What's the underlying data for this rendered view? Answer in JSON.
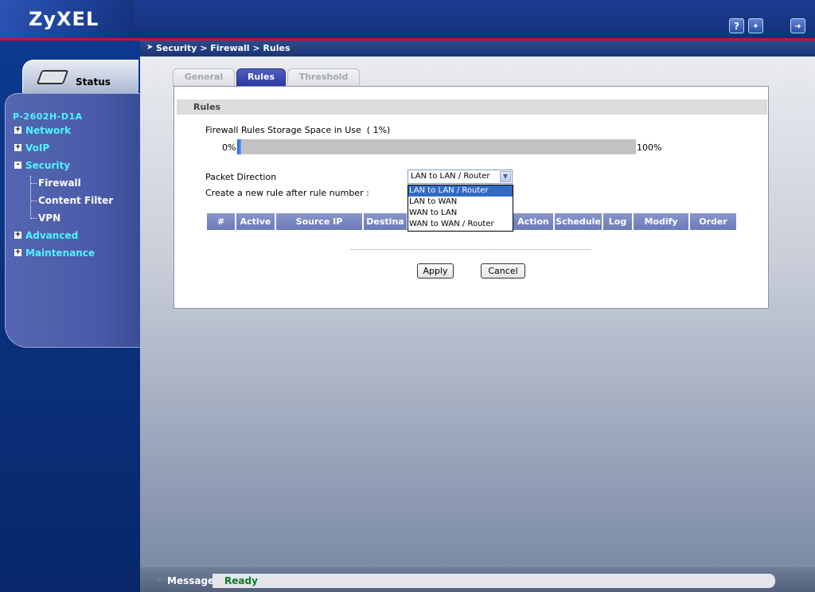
{
  "header": {
    "logo": "ZyXEL",
    "help_icon": "?",
    "wizard_icon": "wand-icon",
    "logout_icon": "logout-icon"
  },
  "sidebar": {
    "status_label": "Status",
    "model": "P-2602H-D1A",
    "items": [
      {
        "label": "Network",
        "toggle": "+"
      },
      {
        "label": "VoIP",
        "toggle": "+"
      },
      {
        "label": "Security",
        "toggle": "-"
      },
      {
        "label": "Advanced",
        "toggle": "+"
      },
      {
        "label": "Maintenance",
        "toggle": "+"
      }
    ],
    "security_sub": [
      "Firewall",
      "Content Filter",
      "VPN"
    ]
  },
  "breadcrumb": "Security > Firewall > Rules",
  "tabs": [
    {
      "label": "General",
      "active": false
    },
    {
      "label": "Rules",
      "active": true
    },
    {
      "label": "Threshold",
      "active": false
    }
  ],
  "section": {
    "title": "Rules",
    "storage_label": "Firewall Rules Storage Space in Use",
    "storage_pct_text": "( 1%)",
    "storage_fraction": 0.01,
    "min_label": "0%",
    "max_label": "100%",
    "packet_direction_label": "Packet Direction",
    "packet_direction_value": "LAN to LAN / Router",
    "packet_direction_options": [
      "LAN to LAN / Router",
      "LAN to WAN",
      "WAN to LAN",
      "WAN to WAN / Router"
    ],
    "new_rule_label": "Create a new rule after rule number :",
    "columns": [
      "#",
      "Active",
      "Source IP",
      "Destina",
      "Action",
      "Schedule",
      "Log",
      "Modify",
      "Order"
    ]
  },
  "buttons": {
    "apply": "Apply",
    "cancel": "Cancel"
  },
  "status_bar": {
    "label": "Message",
    "value": "Ready"
  },
  "colors": {
    "accent": "#28379a",
    "nav_text": "#4ff4ff",
    "ready": "#0c7a2a",
    "header_red": "#c8171e"
  }
}
